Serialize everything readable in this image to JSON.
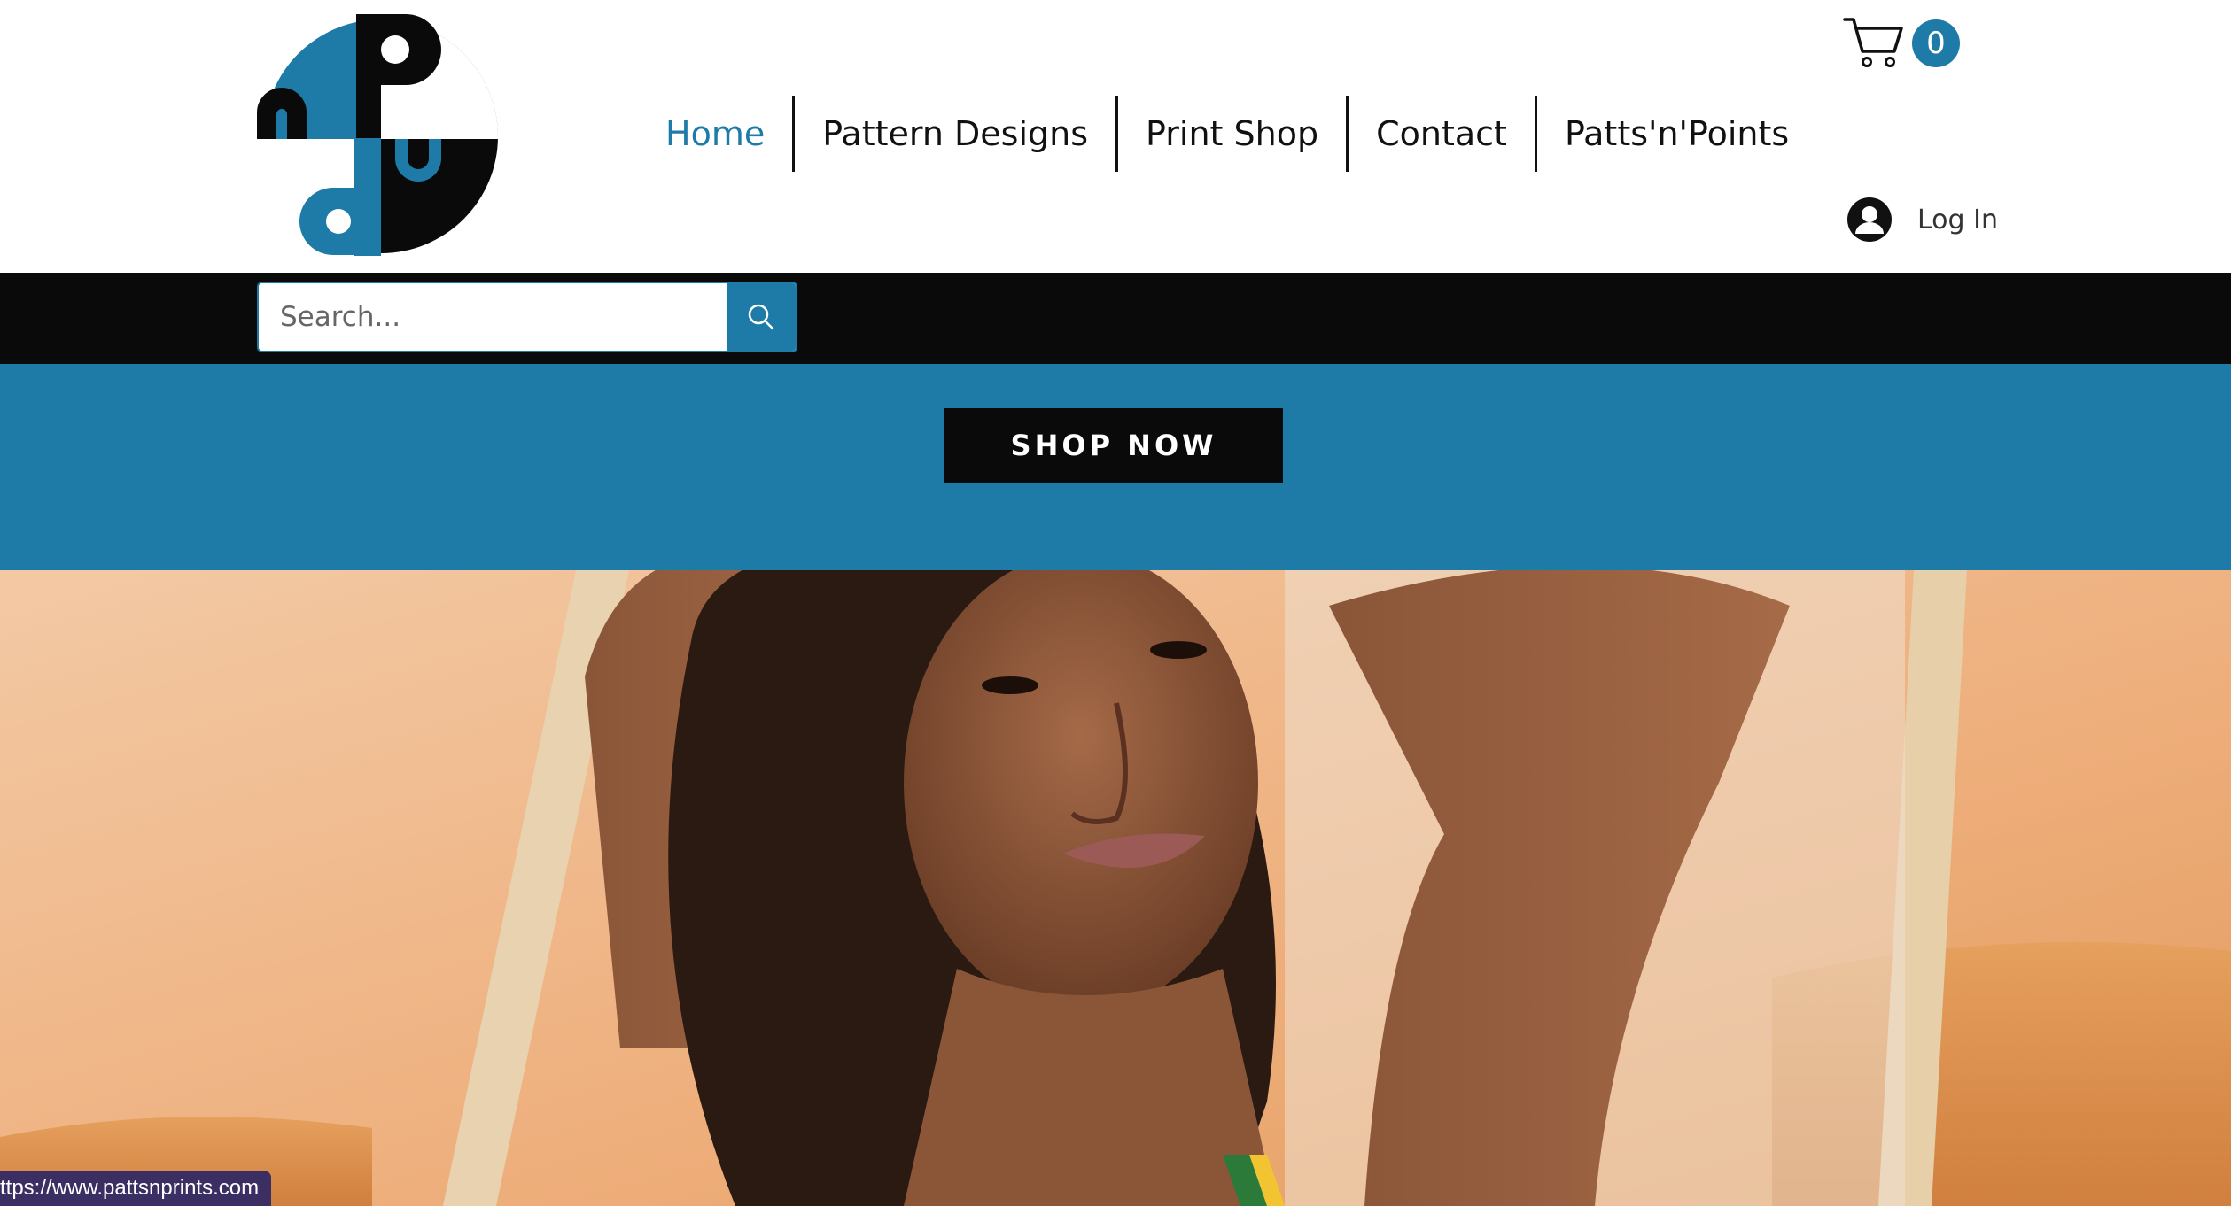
{
  "brand": {
    "logo_letters": "nPdu",
    "colors": {
      "blue": "#1e7ba8",
      "black": "#0a0a0a"
    }
  },
  "nav": {
    "items": [
      {
        "label": "Home",
        "active": true
      },
      {
        "label": "Pattern Designs",
        "active": false
      },
      {
        "label": "Print Shop",
        "active": false
      },
      {
        "label": "Contact",
        "active": false
      },
      {
        "label": "Patts'n'Points",
        "active": false
      }
    ]
  },
  "cart": {
    "icon": "cart-icon",
    "count": "0"
  },
  "login": {
    "icon": "user-avatar-icon",
    "label": "Log In"
  },
  "search": {
    "placeholder": "Search...",
    "value": "",
    "icon": "search-icon"
  },
  "banner": {
    "cta_label": "SHOP NOW"
  },
  "status_bar": {
    "url": "ttps://www.pattsnprints.com"
  }
}
